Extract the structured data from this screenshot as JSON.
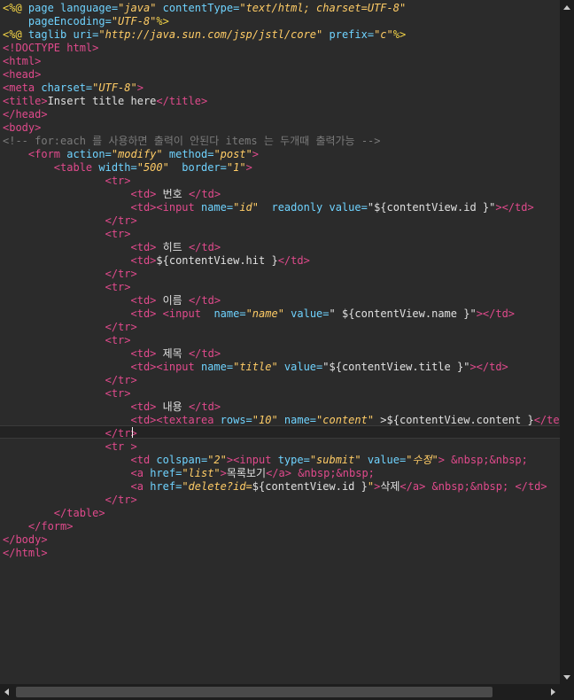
{
  "colors": {
    "background": "#2b2b2b",
    "tag": "#e04a8c",
    "attr": "#6fd3ff",
    "string": "#ffcc66",
    "text": "#e0e0e0",
    "comment": "#7a7a7a",
    "directive": "#f5d547"
  },
  "code": {
    "lines": [
      [
        {
          "t": "<%@",
          "c": "directive"
        },
        {
          "t": " page ",
          "c": "attr"
        },
        {
          "t": "language=",
          "c": "attr"
        },
        {
          "t": "\"java\"",
          "c": "string"
        },
        {
          "t": " contentType=",
          "c": "attr"
        },
        {
          "t": "\"text/html; charset=UTF-8\"",
          "c": "string"
        }
      ],
      [
        {
          "t": "    pageEncoding=",
          "c": "attr"
        },
        {
          "t": "\"UTF-8\"",
          "c": "string"
        },
        {
          "t": "%>",
          "c": "directive"
        }
      ],
      [
        {
          "t": "<%@",
          "c": "directive"
        },
        {
          "t": " taglib ",
          "c": "attr"
        },
        {
          "t": "uri=",
          "c": "attr"
        },
        {
          "t": "\"http://java.sun.com/jsp/jstl/core\"",
          "c": "string"
        },
        {
          "t": " prefix=",
          "c": "attr"
        },
        {
          "t": "\"c\"",
          "c": "string"
        },
        {
          "t": "%>",
          "c": "directive"
        }
      ],
      [
        {
          "t": "<!DOCTYPE html>",
          "c": "tag"
        }
      ],
      [
        {
          "t": "<html>",
          "c": "tag"
        }
      ],
      [
        {
          "t": "<head>",
          "c": "tag"
        }
      ],
      [
        {
          "t": "<meta ",
          "c": "tag"
        },
        {
          "t": "charset=",
          "c": "attr"
        },
        {
          "t": "\"UTF-8\"",
          "c": "string"
        },
        {
          "t": ">",
          "c": "tag"
        }
      ],
      [
        {
          "t": "<title>",
          "c": "tag"
        },
        {
          "t": "Insert title here",
          "c": "text"
        },
        {
          "t": "</title>",
          "c": "tag"
        }
      ],
      [
        {
          "t": "</head>",
          "c": "tag"
        }
      ],
      [
        {
          "t": "<body>",
          "c": "tag"
        }
      ],
      [
        {
          "t": "<!-- for:each 를 사용하면 출력이 안된다 items 는 두개때 출력가능 -->",
          "c": "comment"
        }
      ],
      [
        {
          "t": "    ",
          "c": "text"
        },
        {
          "t": "<form ",
          "c": "tag"
        },
        {
          "t": "action=",
          "c": "attr"
        },
        {
          "t": "\"modify\"",
          "c": "string"
        },
        {
          "t": " method=",
          "c": "attr"
        },
        {
          "t": "\"post\"",
          "c": "string"
        },
        {
          "t": ">",
          "c": "tag"
        }
      ],
      [
        {
          "t": "        ",
          "c": "text"
        },
        {
          "t": "<table ",
          "c": "tag"
        },
        {
          "t": "width=",
          "c": "attr"
        },
        {
          "t": "\"500\"",
          "c": "string"
        },
        {
          "t": "  border=",
          "c": "attr"
        },
        {
          "t": "\"1\"",
          "c": "string"
        },
        {
          "t": ">",
          "c": "tag"
        }
      ],
      [
        {
          "t": "                ",
          "c": "text"
        },
        {
          "t": "<tr>",
          "c": "tag"
        }
      ],
      [
        {
          "t": "                    ",
          "c": "text"
        },
        {
          "t": "<td>",
          "c": "tag"
        },
        {
          "t": " 번호 ",
          "c": "text"
        },
        {
          "t": "</td>",
          "c": "tag"
        }
      ],
      [
        {
          "t": "                    ",
          "c": "text"
        },
        {
          "t": "<td><input ",
          "c": "tag"
        },
        {
          "t": "name=",
          "c": "attr"
        },
        {
          "t": "\"id\"",
          "c": "string"
        },
        {
          "t": "  readonly value=",
          "c": "attr"
        },
        {
          "t": "\"${contentView.id }\"",
          "c": "text"
        },
        {
          "t": "></td>",
          "c": "tag"
        }
      ],
      [
        {
          "t": "                ",
          "c": "text"
        },
        {
          "t": "</tr>",
          "c": "tag"
        }
      ],
      [
        {
          "t": "                ",
          "c": "text"
        },
        {
          "t": "<tr>",
          "c": "tag"
        }
      ],
      [
        {
          "t": "                    ",
          "c": "text"
        },
        {
          "t": "<td>",
          "c": "tag"
        },
        {
          "t": " 히트 ",
          "c": "text"
        },
        {
          "t": "</td>",
          "c": "tag"
        }
      ],
      [
        {
          "t": "                    ",
          "c": "text"
        },
        {
          "t": "<td>",
          "c": "tag"
        },
        {
          "t": "${contentView.hit }",
          "c": "text"
        },
        {
          "t": "</td>",
          "c": "tag"
        }
      ],
      [
        {
          "t": "                ",
          "c": "text"
        },
        {
          "t": "</tr>",
          "c": "tag"
        }
      ],
      [
        {
          "t": "                ",
          "c": "text"
        },
        {
          "t": "<tr>",
          "c": "tag"
        }
      ],
      [
        {
          "t": "                    ",
          "c": "text"
        },
        {
          "t": "<td>",
          "c": "tag"
        },
        {
          "t": " 이름 ",
          "c": "text"
        },
        {
          "t": "</td>",
          "c": "tag"
        }
      ],
      [
        {
          "t": "                    ",
          "c": "text"
        },
        {
          "t": "<td>",
          "c": "tag"
        },
        {
          "t": " ",
          "c": "text"
        },
        {
          "t": "<input ",
          "c": "tag"
        },
        {
          "t": " name=",
          "c": "attr"
        },
        {
          "t": "\"name\"",
          "c": "string"
        },
        {
          "t": " value=",
          "c": "attr"
        },
        {
          "t": "\" ${contentView.name }\"",
          "c": "text"
        },
        {
          "t": "></td>",
          "c": "tag"
        }
      ],
      [
        {
          "t": "                ",
          "c": "text"
        },
        {
          "t": "</tr>",
          "c": "tag"
        }
      ],
      [
        {
          "t": "                ",
          "c": "text"
        },
        {
          "t": "<tr>",
          "c": "tag"
        }
      ],
      [
        {
          "t": "                    ",
          "c": "text"
        },
        {
          "t": "<td>",
          "c": "tag"
        },
        {
          "t": " 제목 ",
          "c": "text"
        },
        {
          "t": "</td>",
          "c": "tag"
        }
      ],
      [
        {
          "t": "                    ",
          "c": "text"
        },
        {
          "t": "<td><input ",
          "c": "tag"
        },
        {
          "t": "name=",
          "c": "attr"
        },
        {
          "t": "\"title\"",
          "c": "string"
        },
        {
          "t": " value=",
          "c": "attr"
        },
        {
          "t": "\"${contentView.title }\"",
          "c": "text"
        },
        {
          "t": "></td>",
          "c": "tag"
        }
      ],
      [
        {
          "t": "                ",
          "c": "text"
        },
        {
          "t": "</tr>",
          "c": "tag"
        }
      ],
      [
        {
          "t": "                ",
          "c": "text"
        },
        {
          "t": "<tr>",
          "c": "tag"
        }
      ],
      [
        {
          "t": "                    ",
          "c": "text"
        },
        {
          "t": "<td>",
          "c": "tag"
        },
        {
          "t": " 내용 ",
          "c": "text"
        },
        {
          "t": "</td>",
          "c": "tag"
        }
      ],
      [
        {
          "t": "                    ",
          "c": "text"
        },
        {
          "t": "<td><textarea ",
          "c": "tag"
        },
        {
          "t": "rows=",
          "c": "attr"
        },
        {
          "t": "\"10\"",
          "c": "string"
        },
        {
          "t": " name=",
          "c": "attr"
        },
        {
          "t": "\"content\"",
          "c": "string"
        },
        {
          "t": " >${contentView.content }",
          "c": "text"
        },
        {
          "t": "</texta",
          "c": "tag"
        }
      ],
      [
        {
          "t": "                ",
          "c": "text"
        },
        {
          "t": "</tr>",
          "c": "tag"
        }
      ],
      [
        {
          "t": "                ",
          "c": "text"
        },
        {
          "t": "<tr ",
          "c": "tag"
        },
        {
          "t": ">",
          "c": "tag"
        }
      ],
      [
        {
          "t": "                    ",
          "c": "text"
        },
        {
          "t": "<td ",
          "c": "tag"
        },
        {
          "t": "colspan=",
          "c": "attr"
        },
        {
          "t": "\"2\"",
          "c": "string"
        },
        {
          "t": "><input ",
          "c": "tag"
        },
        {
          "t": "type=",
          "c": "attr"
        },
        {
          "t": "\"submit\"",
          "c": "string"
        },
        {
          "t": " value=",
          "c": "attr"
        },
        {
          "t": "\"수정\"",
          "c": "string"
        },
        {
          "t": "> ",
          "c": "tag"
        },
        {
          "t": "&nbsp;&nbsp;",
          "c": "tag"
        }
      ],
      [
        {
          "t": "                    ",
          "c": "text"
        },
        {
          "t": "<a ",
          "c": "tag"
        },
        {
          "t": "href=",
          "c": "attr"
        },
        {
          "t": "\"list\"",
          "c": "string"
        },
        {
          "t": ">",
          "c": "tag"
        },
        {
          "t": "목록보기",
          "c": "text"
        },
        {
          "t": "</a> ",
          "c": "tag"
        },
        {
          "t": "&nbsp;&nbsp;",
          "c": "tag"
        }
      ],
      [
        {
          "t": "                    ",
          "c": "text"
        },
        {
          "t": "<a ",
          "c": "tag"
        },
        {
          "t": "href=",
          "c": "attr"
        },
        {
          "t": "\"delete?id=",
          "c": "string"
        },
        {
          "t": "${contentView.id }",
          "c": "text"
        },
        {
          "t": "\"",
          "c": "string"
        },
        {
          "t": ">",
          "c": "tag"
        },
        {
          "t": "삭제",
          "c": "text"
        },
        {
          "t": "</a> ",
          "c": "tag"
        },
        {
          "t": "&nbsp;&nbsp; ",
          "c": "tag"
        },
        {
          "t": "</td>",
          "c": "tag"
        }
      ],
      [
        {
          "t": "                ",
          "c": "text"
        },
        {
          "t": "</tr>",
          "c": "tag"
        }
      ],
      [
        {
          "t": "        ",
          "c": "text"
        },
        {
          "t": "</table>",
          "c": "tag"
        }
      ],
      [
        {
          "t": "    ",
          "c": "text"
        },
        {
          "t": "</form>",
          "c": "tag"
        }
      ],
      [
        {
          "t": "</body>",
          "c": "tag"
        }
      ],
      [
        {
          "t": "</html>",
          "c": "tag"
        }
      ]
    ]
  }
}
